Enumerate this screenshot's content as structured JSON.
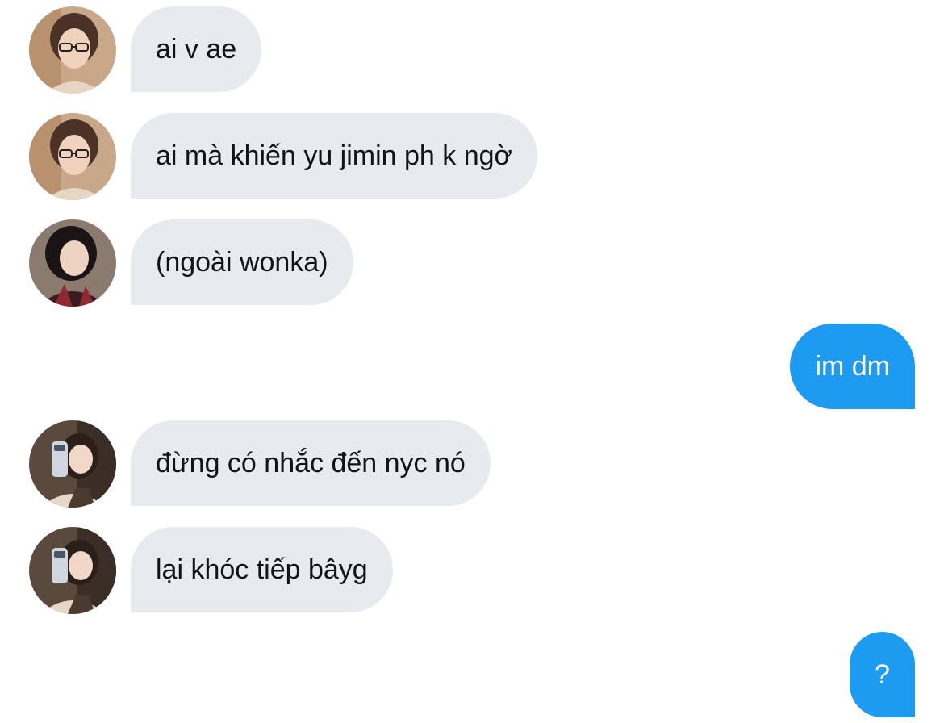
{
  "conversation": {
    "messages": [
      {
        "direction": "incoming",
        "avatar": "avatar-glasses-girl",
        "text": "ai v ae"
      },
      {
        "direction": "incoming",
        "avatar": "avatar-glasses-girl",
        "text": "ai mà khiến yu jimin ph k ngờ"
      },
      {
        "direction": "incoming",
        "avatar": "avatar-dark-hair-girl",
        "text": "(ngoài wonka)"
      },
      {
        "direction": "outgoing",
        "text": "im dm"
      },
      {
        "direction": "incoming",
        "avatar": "avatar-mirror-selfie-girl",
        "text": "đừng có nhắc đến nyc nó"
      },
      {
        "direction": "incoming",
        "avatar": "avatar-mirror-selfie-girl",
        "text": "lại khóc tiếp bâyg"
      },
      {
        "direction": "outgoing",
        "text": "?"
      }
    ]
  },
  "colors": {
    "incoming_bubble": "#e7ebef",
    "outgoing_bubble": "#1d9bf0",
    "incoming_text": "#0f1419",
    "outgoing_text": "#ffffff"
  }
}
